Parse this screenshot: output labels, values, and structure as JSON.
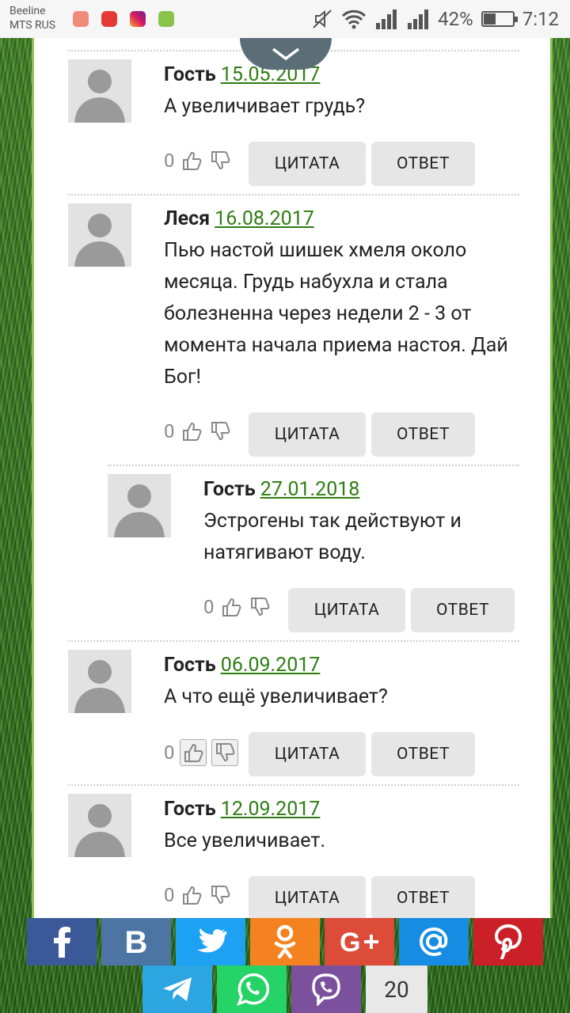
{
  "status": {
    "carrier1": "Beeline",
    "carrier2": "MTS RUS",
    "battery": "42%",
    "battery_level": 0.42,
    "time": "7:12"
  },
  "comments": [
    {
      "author": "Гость",
      "date": "15.05.2017",
      "text": "А увеличивает грудь?",
      "votes": "0",
      "quote": "ЦИТАТА",
      "reply": "ОТВЕТ"
    },
    {
      "author": "Леся",
      "date": "16.08.2017",
      "text": "Пью настой шишек хмеля около месяца. Грудь набухла и стала болезненна через недели 2 - 3 от момента начала приема настоя. Дай Бог!",
      "votes": "0",
      "quote": "ЦИТАТА",
      "reply": "ОТВЕТ"
    },
    {
      "author": "Гость",
      "date": "27.01.2018",
      "text": "Эстрогены так действуют и натягивают воду.",
      "votes": "0",
      "quote": "ЦИТАТА",
      "reply": "ОТВЕТ"
    },
    {
      "author": "Гость",
      "date": "06.09.2017",
      "text": "А что ещё увеличивает?",
      "votes": "0",
      "quote": "ЦИТАТА",
      "reply": "ОТВЕТ"
    },
    {
      "author": "Гость",
      "date": "12.09.2017",
      "text": "Все увеличивает.",
      "votes": "0",
      "quote": "ЦИТАТА",
      "reply": "ОТВЕТ"
    }
  ],
  "share": {
    "colors": {
      "facebook": "#3b5998",
      "vk": "#4c75a3",
      "twitter": "#1da1f2",
      "ok": "#f58220",
      "gplus": "#dd4b39",
      "mail": "#168de2",
      "pinterest": "#cb2027",
      "telegram": "#2ca5e0",
      "whatsapp": "#25d366",
      "viber": "#7b519d"
    },
    "count": "20"
  }
}
